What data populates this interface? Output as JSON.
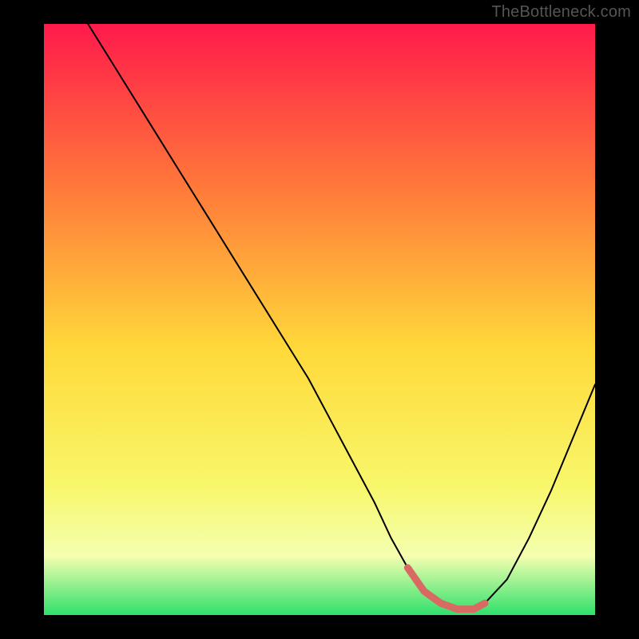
{
  "watermark": "TheBottleneck.com",
  "colors": {
    "frame": "#000000",
    "curve": "#000000",
    "highlight": "#d86a63",
    "gradient_top": "#ff1a4b",
    "gradient_mid_upper": "#ff7a3a",
    "gradient_mid": "#ffd93a",
    "gradient_mid_lower": "#f8f76a",
    "gradient_band": "#f4ffb0",
    "gradient_bottom": "#2fe06b"
  },
  "layout": {
    "inner_x": 55,
    "inner_y": 30,
    "inner_w": 690,
    "inner_h": 740
  },
  "chart_data": {
    "type": "line",
    "title": "",
    "xlabel": "",
    "ylabel": "",
    "x_range": [
      0,
      100
    ],
    "y_range": [
      0,
      100
    ],
    "series": [
      {
        "name": "curve",
        "x": [
          8,
          12,
          16,
          20,
          24,
          28,
          32,
          36,
          40,
          44,
          48,
          52,
          56,
          60,
          63,
          66,
          69,
          72,
          75,
          78,
          80,
          84,
          88,
          92,
          96,
          100
        ],
        "y": [
          100,
          94,
          88,
          82,
          76,
          70,
          64,
          58,
          52,
          46,
          40,
          33,
          26,
          19,
          13,
          8,
          4,
          2,
          1,
          1,
          2,
          6,
          13,
          21,
          30,
          39
        ]
      }
    ],
    "highlight": {
      "x": [
        66,
        69,
        72,
        75,
        78,
        80
      ],
      "y": [
        8,
        4,
        2,
        1,
        1,
        2
      ]
    }
  }
}
